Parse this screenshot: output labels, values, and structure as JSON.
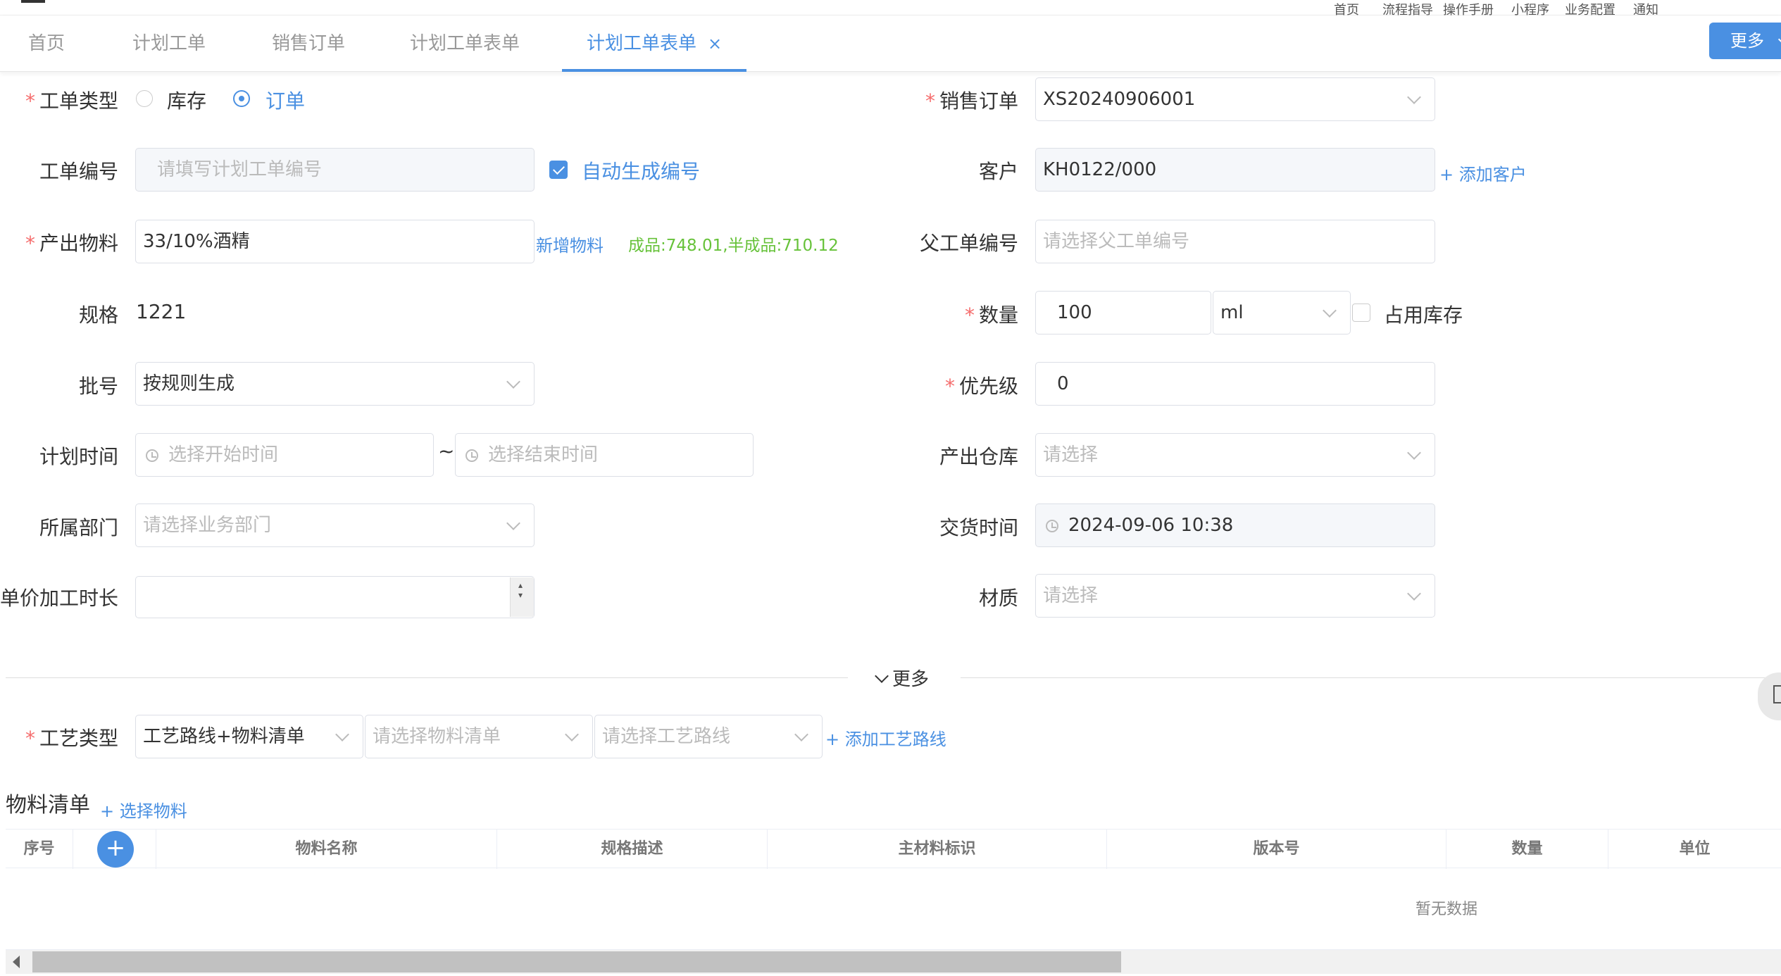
{
  "topnav": {
    "items": [
      "首页",
      "流程指导",
      "操作手册",
      "小程序",
      "业务配置",
      "通知"
    ]
  },
  "tabs": [
    {
      "label": "首页"
    },
    {
      "label": "计划工单"
    },
    {
      "label": "销售订单"
    },
    {
      "label": "计划工单表单"
    },
    {
      "label": "计划工单表单",
      "close": "×"
    }
  ],
  "more_button": {
    "label": "更多"
  },
  "form": {
    "order_type": {
      "label": "工单类型",
      "options": [
        "库存",
        "订单"
      ],
      "selected": "订单"
    },
    "order_no": {
      "label": "工单编号",
      "placeholder": "请填写计划工单编号",
      "auto_label": "自动生成编号",
      "auto_checked": true
    },
    "material": {
      "label": "产出物料",
      "value": "33/10%酒精",
      "add_link": "新增物料",
      "stock_info": "成品:748.01,半成品:710.12"
    },
    "spec": {
      "label": "规格",
      "value": "1221"
    },
    "batch": {
      "label": "批号",
      "value": "按规则生成"
    },
    "plan_time": {
      "label": "计划时间",
      "start_placeholder": "选择开始时间",
      "separator": "~",
      "end_placeholder": "选择结束时间"
    },
    "department": {
      "label": "所属部门",
      "placeholder": "请选择业务部门"
    },
    "unit_time": {
      "label": "单价加工时长",
      "value": ""
    },
    "sales_order": {
      "label": "销售订单",
      "value": "XS20240906001"
    },
    "customer": {
      "label": "客户",
      "value": "KH0122/000",
      "add_link": "+ 添加客户"
    },
    "parent_order": {
      "label": "父工单编号",
      "placeholder": "请选择父工单编号"
    },
    "quantity": {
      "label": "数量",
      "value": "100",
      "unit": "ml",
      "reserve_label": "占用库存"
    },
    "priority": {
      "label": "优先级",
      "value": "0"
    },
    "warehouse": {
      "label": "产出仓库",
      "placeholder": "请选择"
    },
    "delivery_time": {
      "label": "交货时间",
      "value": "2024-09-06 10:38"
    },
    "texture": {
      "label": "材质",
      "placeholder": "请选择"
    },
    "more_toggle": "更多",
    "process_type": {
      "label": "工艺类型",
      "value": "工艺路线+物料清单",
      "bom_placeholder": "请选择物料清单",
      "route_placeholder": "请选择工艺路线",
      "add_route": "添加工艺路线"
    }
  },
  "bom": {
    "title": "物料清单",
    "select_link": "选择物料",
    "columns": [
      "序号",
      "物料名称",
      "规格描述",
      "主材料标识",
      "版本号",
      "数量",
      "单位"
    ],
    "empty_text": "暂无数据"
  },
  "colors": {
    "accent": "#4a90e2",
    "required": "#f56c6c",
    "stock_info": "#67c23a"
  }
}
